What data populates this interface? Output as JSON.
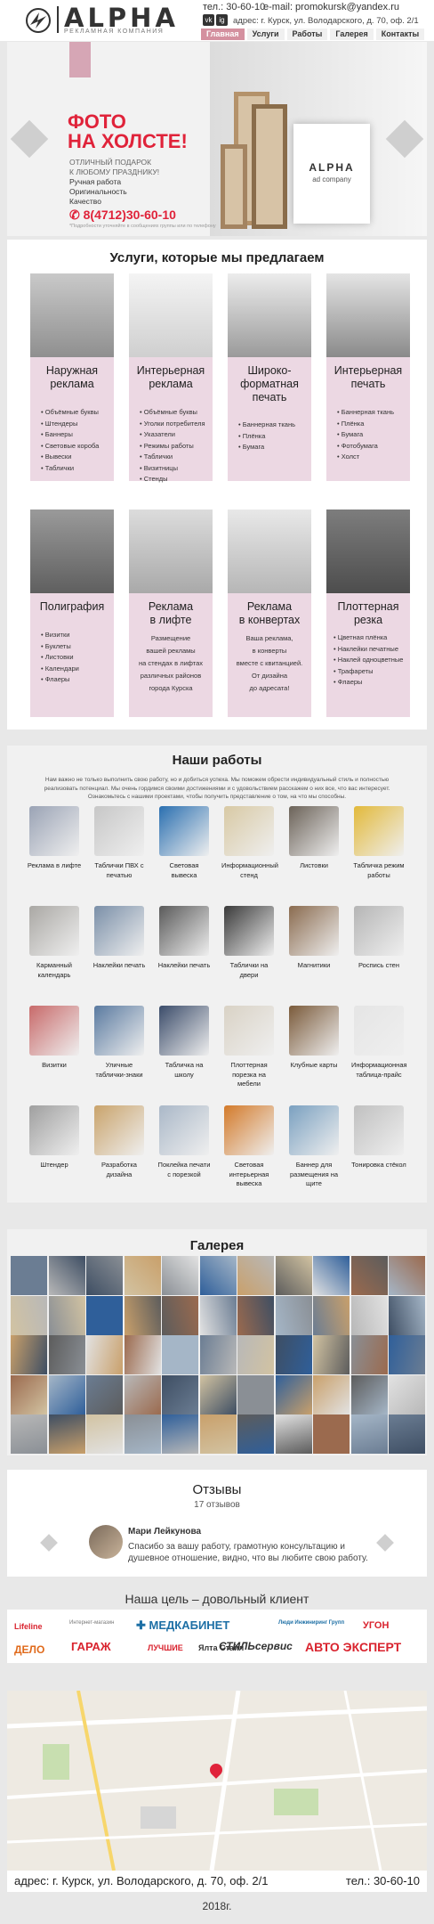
{
  "header": {
    "logo_text": "ALPHA",
    "logo_sub": "РЕКЛАМНАЯ КОМПАНИЯ",
    "phone": "тел.: 30-60-10",
    "email": "e-mail: promokursk@yandex.ru",
    "address": "адрес: г. Курск, ул. Володарского, д. 70, оф. 2/1",
    "social": [
      "vk",
      "ig"
    ],
    "nav": [
      "Главная",
      "Услуги",
      "Работы",
      "Галерея",
      "Контакты"
    ]
  },
  "hero": {
    "title_line1": "ФОТО",
    "title_line2": "НА ХОЛСТЕ!",
    "gift_line1": "ОТЛИЧНЫЙ ПОДАРОК",
    "gift_line2": "К ЛЮБОМУ ПРАЗДНИКУ!",
    "features": [
      "Ручная работа",
      "Оригинальность",
      "Качество"
    ],
    "phone": "8(4712)30-60-10",
    "note": "*Подробности уточняйте в сообщениях группы или по телефону",
    "canvas_title": "ALPHA",
    "canvas_sub": "ad company"
  },
  "services": {
    "title": "Услуги, которые мы предлагаем",
    "cards": [
      {
        "title": "Наружная реклама",
        "items": [
          "Объёмные буквы",
          "Штендеры",
          "Баннеры",
          "Световые короба",
          "Вывески",
          "Таблички"
        ],
        "img_text": "ALPHA ad company"
      },
      {
        "title": "Интерьерная реклама",
        "items": [
          "Объёмные буквы",
          "Уголки потребителя",
          "Указатели",
          "Режимы работы",
          "Таблички",
          "Визитницы",
          "Стенды"
        ],
        "img_text": "ALPHA"
      },
      {
        "title": "Широко-форматная печать",
        "items": [
          "Баннерная ткань",
          "Плёнка",
          "Бумага"
        ],
        "img_text": "ALPHA"
      },
      {
        "title": "Интерьерная печать",
        "items": [
          "Баннерная ткань",
          "Плёнка",
          "Бумага",
          "Фотобумага",
          "Холст"
        ],
        "img_text": ""
      },
      {
        "title": "Полиграфия",
        "items": [
          "Визитки",
          "Буклеты",
          "Листовки",
          "Календари",
          "Флаеры"
        ],
        "img_text": ""
      },
      {
        "title": "Реклама в лифте",
        "text": [
          "Размещение",
          "вашей рекламы",
          "на стендах в лифтах",
          "различных районов",
          "города Курска"
        ],
        "img_text": "ALPHA"
      },
      {
        "title": "Реклама в конвертах",
        "text": [
          "Ваша реклама,",
          "в конверты",
          "вместе с квитанцией.",
          "От дизайна",
          "до адресата!"
        ],
        "img_text": ""
      },
      {
        "title": "Плоттерная резка",
        "items": [
          "Цветная плёнка",
          "Наклейки печатные",
          "Наклей одноцветные",
          "Трафареты",
          "Флаеры"
        ],
        "img_text": ""
      }
    ]
  },
  "works": {
    "title": "Наши работы",
    "intro": "Нам важно не только выполнить свою работу, но и добиться успеха. Мы поможем обрести индивидуальный стиль и полностью реализовать потенциал. Мы очень гордимся своими достижениями и с удовольствием расскажем о них все, что вас интересует. Ознакомьтесь с нашими проектами, чтобы получить представление о том, на что мы способны.",
    "items": [
      "Реклама в лифте",
      "Таблички ПВХ с печатью",
      "Световая вывеска",
      "Информационный стенд",
      "Листовки",
      "Табличка режим работы",
      "Карманный календарь",
      "Наклейки печать",
      "Наклейки печать",
      "Таблички на двери",
      "Магнитики",
      "Роспись стен",
      "Визитки",
      "Уличные таблички-знаки",
      "Табличка на школу",
      "Плоттерная порезка на мебели",
      "Клубные карты",
      "Информационная таблица-прайс",
      "Штендер",
      "Разработка дизайна",
      "Поклейка печати с порезкой",
      "Световая интерьерная вывеска",
      "Баннер для размещения на щите",
      "Тонировка стёкол"
    ]
  },
  "gallery": {
    "title": "Галерея"
  },
  "reviews": {
    "title": "Отзывы",
    "count": "17 отзывов",
    "author": "Мари Лейкунова",
    "text": "Спасибо за вашу работу, грамотную консультацию и душевное отношение, видно, что вы любите свою работу."
  },
  "goal": "Наша цель  – довольный клиент",
  "partners": [
    {
      "name": "Lifeline",
      "color": "#d9232e"
    },
    {
      "name": "Интернет-магазин",
      "color": "#777777"
    },
    {
      "name": "МЕДКАБИНЕТ",
      "color": "#1d6fa5"
    },
    {
      "name": "Люди Инжиниринг Групп",
      "color": "#1d6fa5"
    },
    {
      "name": "УГОН",
      "color": "#d9232e"
    },
    {
      "name": "ДЕЛО",
      "color": "#e06a1b"
    },
    {
      "name": "ГАРАЖ",
      "color": "#d9232e"
    },
    {
      "name": "ЛУЧШИЕ",
      "color": "#d9232e"
    },
    {
      "name": "Ялта Стайл",
      "color": "#333333"
    },
    {
      "name": "СТИЛЬсервис",
      "color": "#333333"
    },
    {
      "name": "АВТО ЭКСПЕРТ",
      "color": "#d9232e"
    }
  ],
  "contacts": {
    "address": "адрес: г. Курск, ул. Володарского, д. 70, оф. 2/1",
    "phone": "тел.: 30-60-10"
  },
  "footer": {
    "year": "2018г."
  }
}
